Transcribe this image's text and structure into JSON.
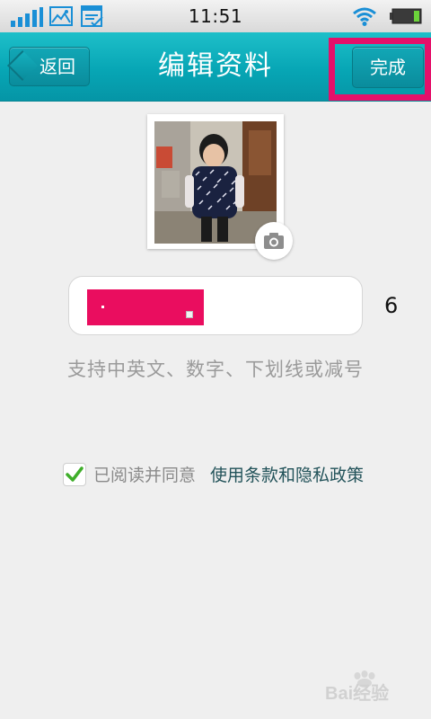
{
  "status_bar": {
    "time": "11:51",
    "icons": [
      "signal-icon",
      "image-notification-icon",
      "document-notification-icon",
      "wifi-icon",
      "battery-icon"
    ]
  },
  "header": {
    "back_label": "返回",
    "title": "编辑资料",
    "done_label": "完成"
  },
  "profile": {
    "avatar": "child-photo",
    "camera_icon": "camera-icon"
  },
  "nickname": {
    "char_count": "6",
    "hint": "支持中英文、数字、下划线或减号"
  },
  "agreement": {
    "checked": true,
    "label": "已阅读并同意",
    "link": "使用条款和隐私政策"
  },
  "watermark": {
    "text": "Bai经验"
  },
  "colors": {
    "nav_bar": "#0aa6b6",
    "highlight": "#e5106a",
    "redaction": "#ea0d5f",
    "checkmark": "#3fae2a",
    "link": "#23535a",
    "status_icons": "#1a8fd6"
  }
}
